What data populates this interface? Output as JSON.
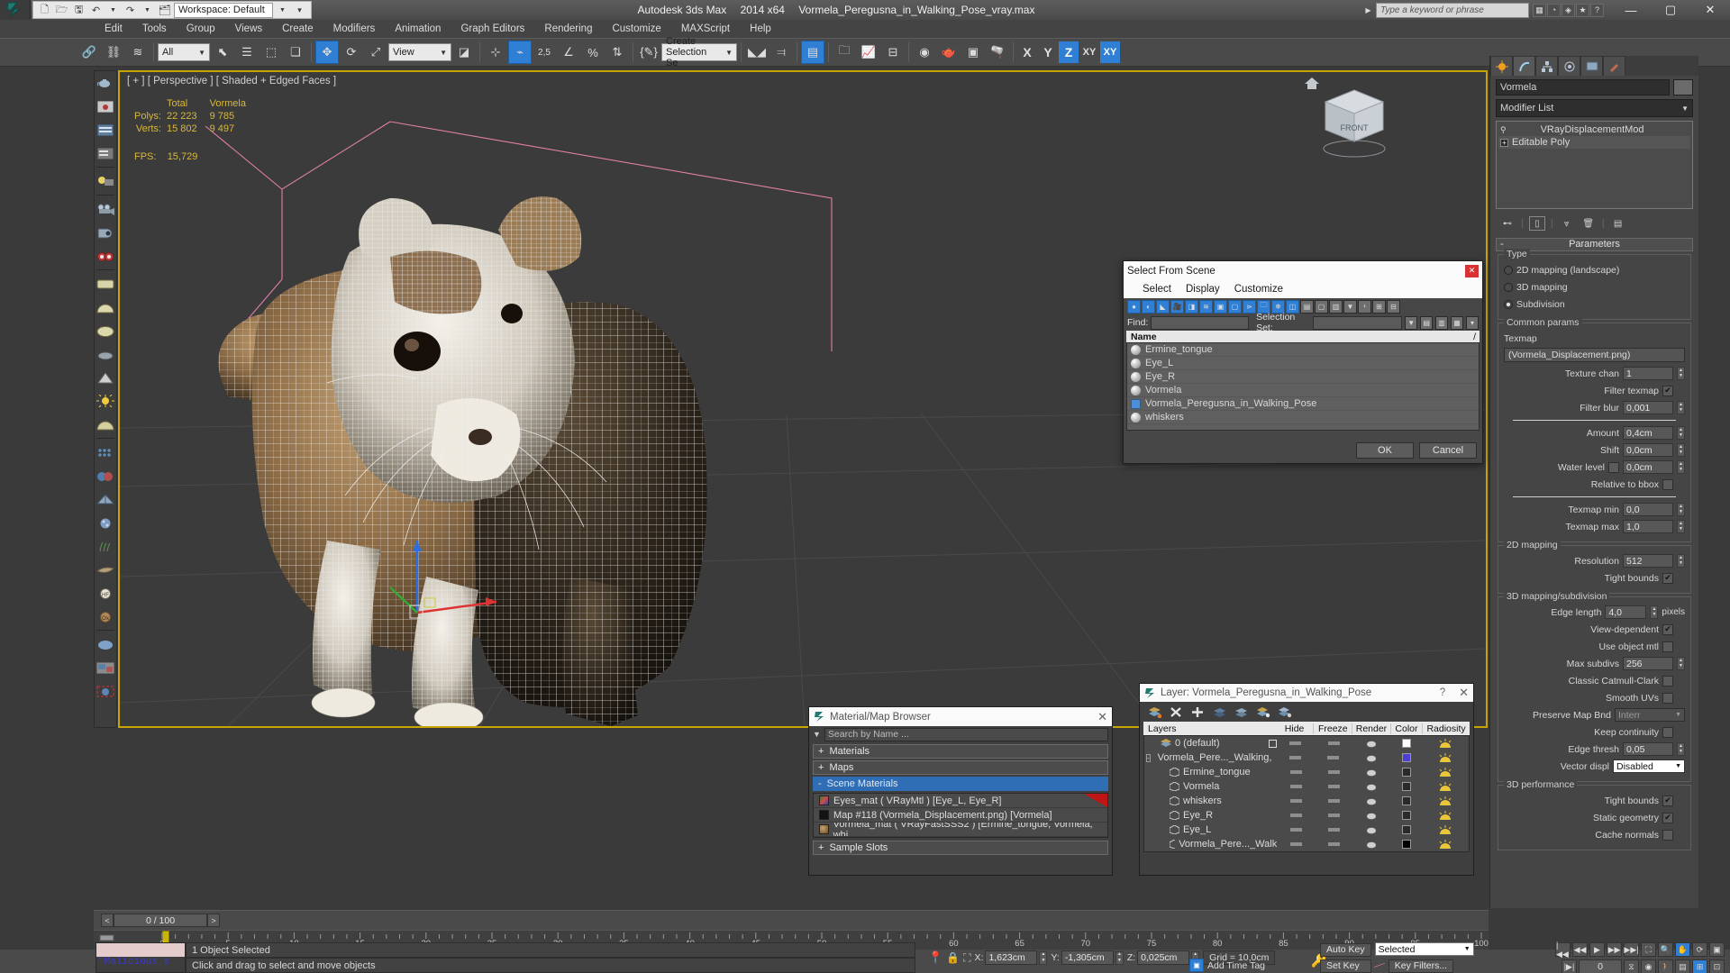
{
  "titlebar": {
    "app_name": "Autodesk 3ds Max",
    "version": "2014 x64",
    "filename": "Vormela_Peregusna_in_Walking_Pose_vray.max",
    "workspace": "Workspace: Default",
    "search_placeholder": "Type a keyword or phrase",
    "quick_access": [
      "new-icon",
      "open-icon",
      "save-icon",
      "undo-icon",
      "redo-icon",
      "setproject-icon"
    ],
    "window_buttons": [
      "minimize",
      "maximize",
      "close"
    ]
  },
  "menubar": {
    "items": [
      "Edit",
      "Tools",
      "Group",
      "Views",
      "Create",
      "Modifiers",
      "Animation",
      "Graph Editors",
      "Rendering",
      "Customize",
      "MAXScript",
      "Help"
    ]
  },
  "toolbar": {
    "selection_filter": "All",
    "reference_coord": "View",
    "named_selection_set": "Create Selection Se",
    "angle_snap_value": "2,5",
    "percent_label": "%",
    "axis_buttons": [
      "X",
      "Y",
      "Z",
      "XY"
    ],
    "active_axis": "Z"
  },
  "viewport": {
    "label": "[ + ] [ Perspective ] [ Shaded + Edged Faces ]",
    "stats": {
      "col_headers": [
        "",
        "Total",
        "Vormela"
      ],
      "rows": [
        {
          "label": "Polys:",
          "total": "22 223",
          "object": "9 785"
        },
        {
          "label": "Verts:",
          "total": "15 802",
          "object": "9 497"
        }
      ],
      "fps_label": "FPS:",
      "fps_value": "15,729"
    }
  },
  "command_panel": {
    "tabs": [
      "create-tab",
      "modify-tab",
      "hierarchy-tab",
      "motion-tab",
      "display-tab",
      "utilities-tab"
    ],
    "active_tab": "modify-tab",
    "object_name": "Vormela",
    "modifier_list_label": "Modifier List",
    "modifier_stack": [
      {
        "name": "VRayDisplacementMod",
        "icon": "lightbulb-icon"
      },
      {
        "name": "Editable Poly",
        "icon": "plus-box-icon"
      }
    ],
    "rollout_title": "Parameters",
    "type_group": {
      "title": "Type",
      "options": [
        {
          "label": "2D mapping (landscape)",
          "selected": false
        },
        {
          "label": "3D mapping",
          "selected": false
        },
        {
          "label": "Subdivision",
          "selected": true
        }
      ]
    },
    "common_params": {
      "title": "Common params",
      "texmap_label": "Texmap",
      "texmap_value": "(Vormela_Displacement.png)",
      "rows": [
        {
          "label": "Texture chan",
          "value": "1",
          "type": "spinner"
        },
        {
          "label": "Filter texmap",
          "value": "",
          "type": "checkbox",
          "checked": true
        },
        {
          "label": "Filter blur",
          "value": "0,001",
          "type": "spinner"
        },
        {
          "label": "Amount",
          "value": "0,4cm",
          "type": "spinner"
        },
        {
          "label": "Shift",
          "value": "0,0cm",
          "type": "spinner"
        },
        {
          "label": "Water level",
          "value": "0,0cm",
          "type": "spinner-check",
          "checked": false
        },
        {
          "label": "Relative to bbox",
          "value": "",
          "type": "checkbox",
          "checked": false
        },
        {
          "label": "Texmap min",
          "value": "0,0",
          "type": "spinner"
        },
        {
          "label": "Texmap max",
          "value": "1,0",
          "type": "spinner"
        }
      ]
    },
    "mapping_2d": {
      "title": "2D mapping",
      "rows": [
        {
          "label": "Resolution",
          "value": "512",
          "type": "spinner"
        },
        {
          "label": "Tight bounds",
          "value": "",
          "type": "checkbox",
          "checked": true
        }
      ]
    },
    "mapping_3d": {
      "title": "3D mapping/subdivision",
      "rows": [
        {
          "label": "Edge length",
          "value": "4,0",
          "type": "spinner",
          "suffix": "pixels"
        },
        {
          "label": "View-dependent",
          "value": "",
          "type": "checkbox",
          "checked": true
        },
        {
          "label": "Use object mtl",
          "value": "",
          "type": "checkbox",
          "checked": false
        },
        {
          "label": "Max subdivs",
          "value": "256",
          "type": "spinner"
        },
        {
          "label": "Classic Catmull-Clark",
          "value": "",
          "type": "checkbox",
          "checked": false
        },
        {
          "label": "Smooth UVs",
          "value": "",
          "type": "checkbox",
          "checked": false
        },
        {
          "label": "Preserve Map Bnd",
          "value": "Interr",
          "type": "dropdown-dim"
        },
        {
          "label": "Keep continuity",
          "value": "",
          "type": "checkbox",
          "checked": false
        },
        {
          "label": "Edge thresh",
          "value": "0,05",
          "type": "spinner"
        },
        {
          "label": "Vector displ",
          "value": "Disabled",
          "type": "dropdown"
        }
      ]
    },
    "performance_3d": {
      "title": "3D performance",
      "rows": [
        {
          "label": "Tight bounds",
          "value": "",
          "type": "checkbox",
          "checked": true
        },
        {
          "label": "Static geometry",
          "value": "",
          "type": "checkbox",
          "checked": true
        },
        {
          "label": "Cache normals",
          "value": "",
          "type": "checkbox",
          "checked": false
        }
      ]
    }
  },
  "select_from_scene": {
    "title": "Select From Scene",
    "menu": [
      "Select",
      "Display",
      "Customize"
    ],
    "find_label": "Find:",
    "find_value": "",
    "selection_set_label": "Selection Set:",
    "selection_set_value": "",
    "column_header": "Name",
    "items": [
      {
        "name": "Ermine_tongue",
        "icon": "sphere-icon"
      },
      {
        "name": "Eye_L",
        "icon": "sphere-icon"
      },
      {
        "name": "Eye_R",
        "icon": "sphere-icon"
      },
      {
        "name": "Vormela",
        "icon": "sphere-icon"
      },
      {
        "name": "Vormela_Peregusna_in_Walking_Pose",
        "icon": "group-icon"
      },
      {
        "name": "whiskers",
        "icon": "sphere-icon"
      }
    ],
    "ok_label": "OK",
    "cancel_label": "Cancel"
  },
  "material_browser": {
    "title": "Material/Map Browser",
    "search_placeholder": "Search by Name ...",
    "sections": [
      {
        "label": "Materials",
        "sign": "+",
        "selected": false
      },
      {
        "label": "Maps",
        "sign": "+",
        "selected": false
      },
      {
        "label": "Scene Materials",
        "sign": "-",
        "selected": true
      }
    ],
    "scene_materials": [
      {
        "name": "Eyes_mat  ( VRayMtl )  [Eye_L, Eye_R]",
        "swatch": "#6a8a4a",
        "has_red_corner": true
      },
      {
        "name": "Map #118 (Vormela_Displacement.png)  [Vormela]",
        "swatch": "#1a1a1a",
        "has_red_corner": false
      },
      {
        "name": "Vormela_mat  ( VRayFastSSS2 )  [Ermine_tongue, Vormela, whi...",
        "swatch": "#8a6a44",
        "has_red_corner": false
      }
    ],
    "footer_section": {
      "label": "Sample Slots",
      "sign": "+"
    }
  },
  "layer_dialog": {
    "title": "Layer: Vormela_Peregusna_in_Walking_Pose",
    "help_label": "?",
    "toolbar_icons": [
      "create-new-layer-icon",
      "delete-layer-icon",
      "add-selection-icon",
      "select-objects-icon",
      "select-highlighted-icon",
      "set-current-layer-icon",
      "layer-properties-icon"
    ],
    "columns": [
      "Layers",
      "",
      "Hide",
      "Freeze",
      "Render",
      "Color",
      "Radiosity"
    ],
    "rows": [
      {
        "name": "0 (default)",
        "indent": 1,
        "icon": "layer-icon",
        "current": false,
        "box": true,
        "color": "#ffffff"
      },
      {
        "name": "Vormela_Pere..._Walking,",
        "indent": 0,
        "icon": "layer-icon",
        "current": true,
        "box": false,
        "color": "#4d3fd6",
        "expander": "-"
      },
      {
        "name": "Ermine_tongue",
        "indent": 2,
        "icon": "object-icon",
        "current": false,
        "box": false,
        "color": "#2a2a2a"
      },
      {
        "name": "Vormela",
        "indent": 2,
        "icon": "object-icon",
        "current": false,
        "box": false,
        "color": "#2a2a2a"
      },
      {
        "name": "whiskers",
        "indent": 2,
        "icon": "object-icon",
        "current": false,
        "box": false,
        "color": "#2a2a2a"
      },
      {
        "name": "Eye_R",
        "indent": 2,
        "icon": "object-icon",
        "current": false,
        "box": false,
        "color": "#2a2a2a"
      },
      {
        "name": "Eye_L",
        "indent": 2,
        "icon": "object-icon",
        "current": false,
        "box": false,
        "color": "#2a2a2a"
      },
      {
        "name": "Vormela_Pere..._Walk",
        "indent": 2,
        "icon": "object-icon",
        "current": false,
        "box": false,
        "color": "#000000"
      }
    ]
  },
  "timeline": {
    "current_frame": "0 / 100",
    "prev_label": "<",
    "next_label": ">",
    "tick_labels": [
      "0",
      "5",
      "10",
      "15",
      "20",
      "25",
      "30",
      "35",
      "40",
      "45",
      "50",
      "55",
      "60",
      "65",
      "70",
      "75",
      "80",
      "85",
      "90",
      "95",
      "100"
    ],
    "range_start": 0,
    "range_end": 100
  },
  "statusbar": {
    "macro_text": "\"Malicious s",
    "selection_status": "1 Object Selected",
    "prompt": "Click and drag to select and move objects",
    "coords": [
      {
        "axis": "X:",
        "value": "1,623cm"
      },
      {
        "axis": "Y:",
        "value": "-1,305cm"
      },
      {
        "axis": "Z:",
        "value": "0,025cm"
      }
    ],
    "grid_label": "Grid = 10,0cm",
    "add_time_tag": "Add Time Tag",
    "auto_key": "Auto Key",
    "set_key": "Set Key",
    "key_mode": "Selected",
    "key_filters": "Key Filters..."
  }
}
